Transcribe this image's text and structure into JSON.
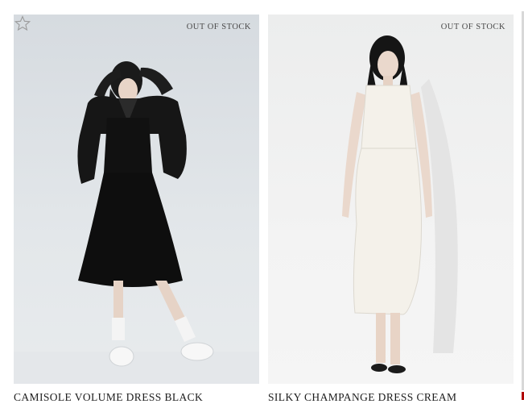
{
  "products": [
    {
      "badge": "OUT OF STOCK",
      "title": "CAMISOLE VOLUME DRESS BLACK",
      "image_icon": "product-photo-icon",
      "wishlist_icon": "star-outline-icon"
    },
    {
      "badge": "OUT OF STOCK",
      "title": "SILKY CHAMPANGE DRESS CREAM",
      "image_icon": "product-photo-icon"
    }
  ],
  "colors": {
    "text": "#1c1c1c",
    "badge": "#4a4a4a",
    "accent_edge": "#b00000"
  }
}
